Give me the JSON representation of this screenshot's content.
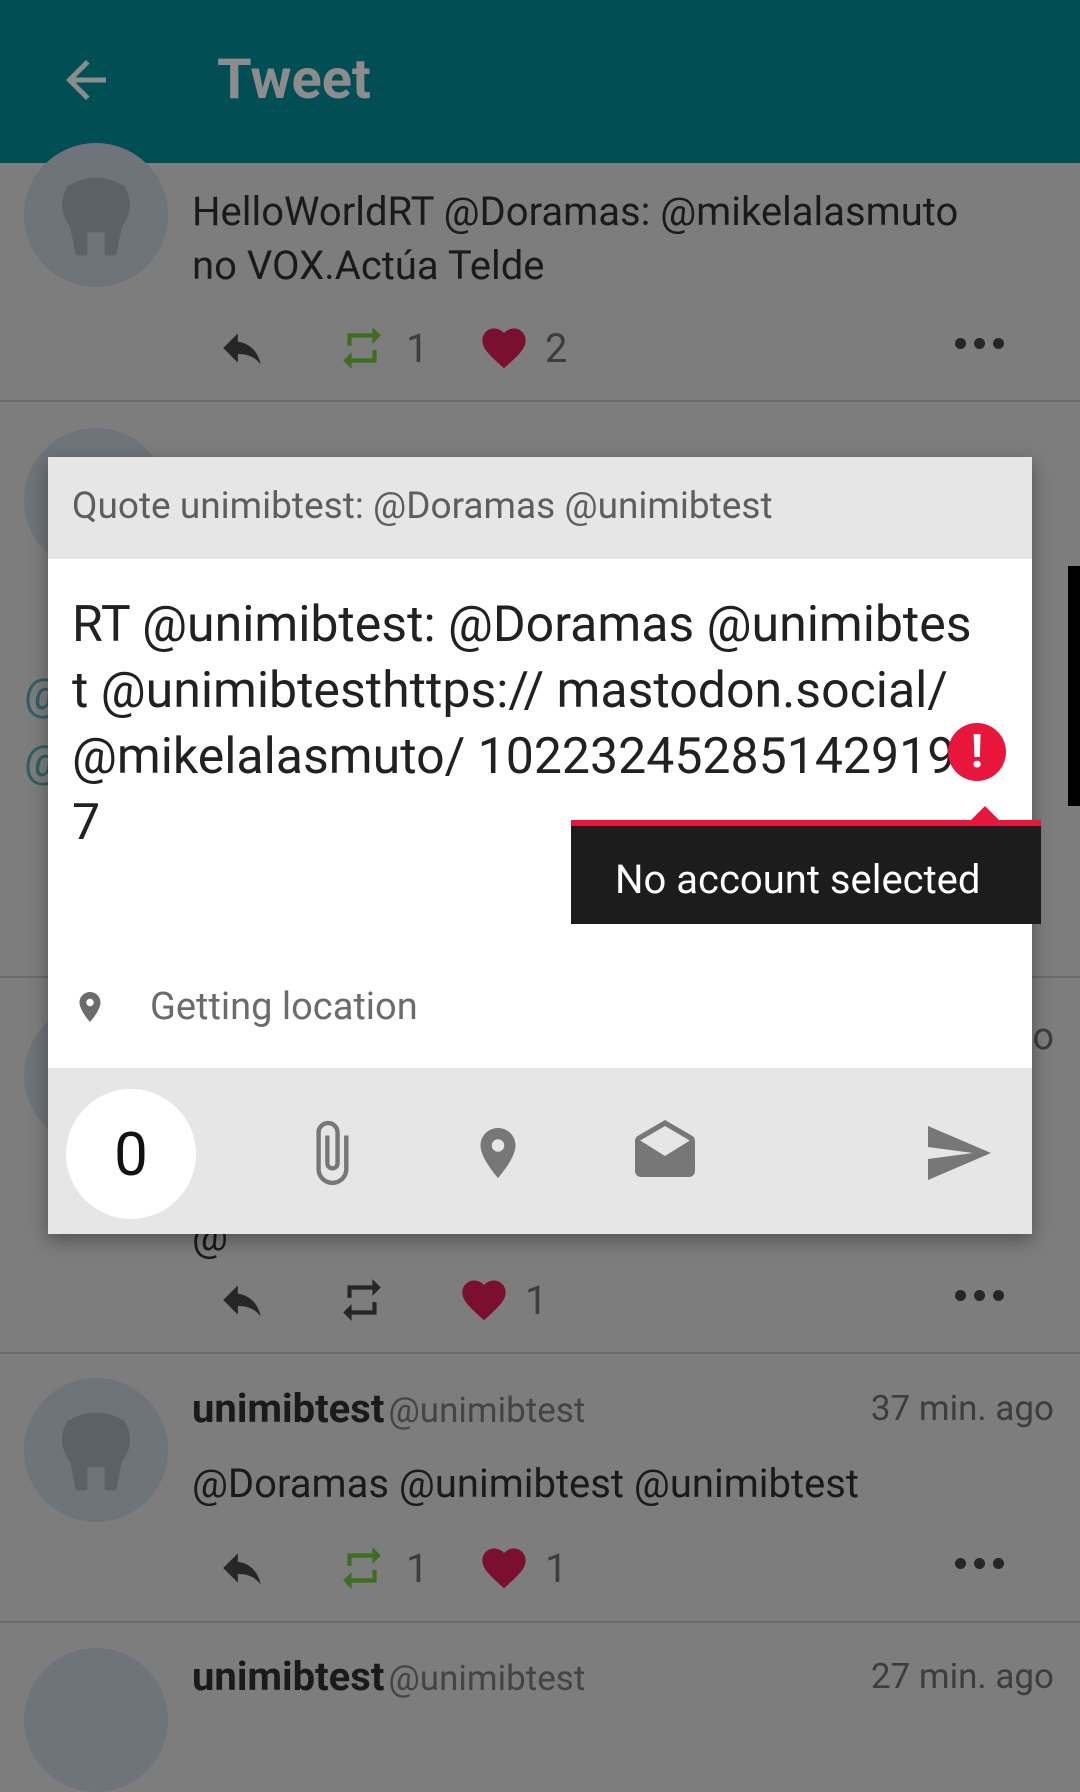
{
  "appbar": {
    "title": "Tweet"
  },
  "timeline": {
    "tweet1": {
      "text_line1": "HelloWorldRT @Doramas: @mikelalasmuto",
      "text_line2": "no VOX.Actúa Telde",
      "retweets": "1",
      "likes": "2"
    },
    "partial_left": [
      "@",
      "@"
    ],
    "partial_right_o": "o",
    "partial_at": "@",
    "tweet3": {
      "likes": "1"
    },
    "tweet4": {
      "name": "unimibtest",
      "handle": "@unimibtest",
      "time": "37 min. ago",
      "text": "@Doramas @unimibtest @unimibtest",
      "retweets": "1",
      "likes": "1"
    },
    "tweet5": {
      "name": "unimibtest",
      "handle": "@unimibtest",
      "time": "27 min. ago"
    }
  },
  "dialog": {
    "header": "Quote unimibtest: @Doramas @unimibtest",
    "body": "RT @unimibtest: @Doramas @unimibtest @unimibtesthttps:// mastodon.social/ @mikelalasmuto/ 102232452851429197",
    "location_label": "Getting location",
    "char_count": "0",
    "error_tooltip": "No account selected"
  },
  "colors": {
    "appbar": "#014e55",
    "error": "#e8163d",
    "retweet": "#3b6e1f",
    "like": "#7a0f2f"
  },
  "icons": [
    "back-arrow-icon",
    "reply-icon",
    "retweet-icon",
    "heart-icon",
    "more-icon",
    "location-pin-icon",
    "attachment-icon",
    "envelope-icon",
    "send-icon",
    "error-icon"
  ]
}
